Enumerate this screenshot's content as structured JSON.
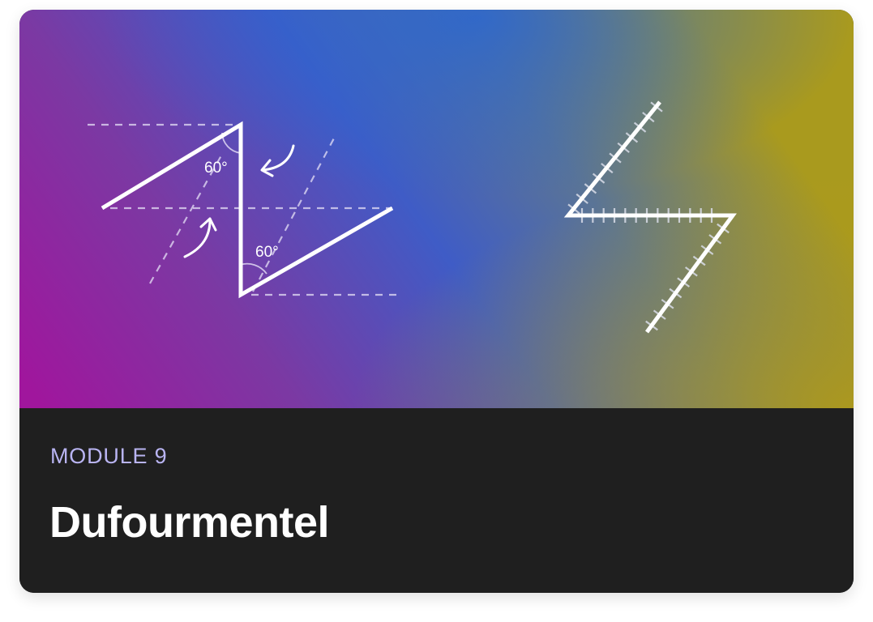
{
  "card": {
    "module_label": "MODULE 9",
    "title": "Dufourmentel"
  },
  "illustration": {
    "angle_top": "60°",
    "angle_bottom": "60°",
    "icons": [
      "z-plasty-angle-diagram-icon",
      "lightning-incision-icon"
    ]
  },
  "colors": {
    "gradient_stops": [
      "#a0169d",
      "#2f64c7",
      "#a99a1e"
    ],
    "caption_background": "#1f1f1f",
    "eyebrow": "#b9b4f2",
    "title": "#ffffff"
  }
}
